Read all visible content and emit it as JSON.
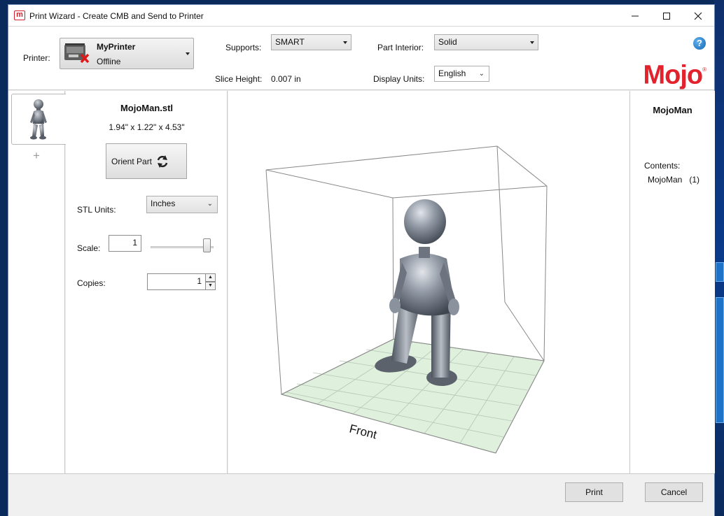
{
  "window": {
    "title": "Print Wizard - Create CMB and Send to Printer",
    "app_icon": "m"
  },
  "toolbar": {
    "printer_label": "Printer:",
    "printer_name": "MyPrinter",
    "printer_status": "Offline",
    "supports_label": "Supports:",
    "supports_value": "SMART",
    "part_interior_label": "Part Interior:",
    "part_interior_value": "Solid",
    "slice_height_label": "Slice Height:",
    "slice_height_value": "0.007 in",
    "display_units_label": "Display Units:",
    "display_units_value": "English",
    "help_label": "?",
    "logo_text": "Mojo",
    "logo_mark": "®"
  },
  "tabs": {
    "add_label": "+"
  },
  "part": {
    "file_name": "MojoMan.stl",
    "dimensions": "1.94\" x 1.22\" x 4.53\"",
    "orient_button": "Orient Part",
    "stl_units_label": "STL Units:",
    "stl_units_value": "Inches",
    "scale_label": "Scale:",
    "scale_value": "1",
    "copies_label": "Copies:",
    "copies_value": "1"
  },
  "viewport": {
    "front_label": "Front"
  },
  "contents": {
    "title": "MojoMan",
    "contents_label": "Contents:",
    "item_name": "MojoMan",
    "item_count": "(1)"
  },
  "footer": {
    "print_button": "Print",
    "cancel_button": "Cancel"
  },
  "colors": {
    "brand": "#e2222c",
    "plate": "#dff0dd",
    "figure": "#8a929e"
  }
}
